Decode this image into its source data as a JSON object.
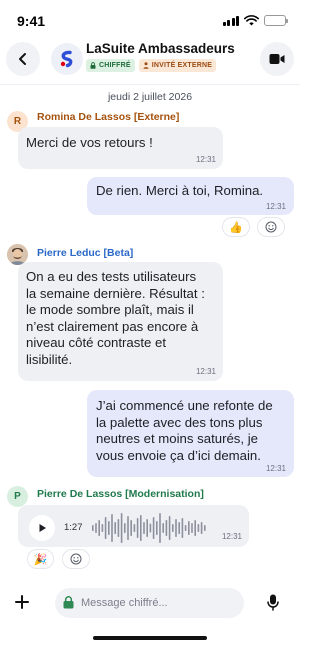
{
  "status_bar": {
    "time": "9:41"
  },
  "header": {
    "title": "LaSuite Ambassadeurs",
    "badges": {
      "encrypted": "CHIFFRÉ",
      "external": "INVITÉ EXTERNE"
    }
  },
  "chat": {
    "date_separator": "jeudi 2 juillet 2026",
    "messages": [
      {
        "sender": "Romina De Lassos [Externe]",
        "initial": "R",
        "text": "Merci de vos retours !",
        "time": "12:31"
      },
      {
        "text": "De rien. Merci à toi, Romina.",
        "time": "12:31",
        "reactions": [
          "👍",
          "☺"
        ]
      },
      {
        "sender": "Pierre Leduc [Beta]",
        "text": "On a eu des tests utilisateurs\nla semaine dernière. Résultat :\nle mode sombre plaît, mais il\nn’est clairement pas encore à\nniveau côté contraste et\nlisibilité.",
        "time": "12:31"
      },
      {
        "text": "J’ai commencé une refonte de\nla palette avec des tons plus\nneutres et moins saturés, je\nvous envoie ça d’ici demain.",
        "time": "12:31"
      },
      {
        "sender": "Pierre De Lassos [Modernisation]",
        "initial": "P",
        "audio_duration": "1:27",
        "time": "12:31",
        "reactions": [
          "🎉",
          "☺"
        ]
      }
    ]
  },
  "composer": {
    "placeholder": "Message chiffré..."
  },
  "colors": {
    "accent": "#2f63d0",
    "sender_orange": "#a5520f",
    "sender_blue": "#2a68c8",
    "sender_green": "#1f7a4c"
  }
}
